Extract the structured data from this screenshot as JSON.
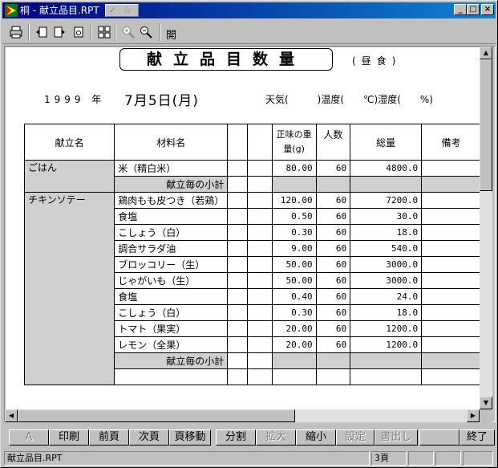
{
  "window": {
    "title": "桐 - 献立品目.RPT",
    "title_ghost": "CC"
  },
  "toolbar": {
    "open_label": "開"
  },
  "report": {
    "title": "献立品目数量",
    "meal": "(昼食)",
    "year": "1999 年",
    "month_day": "7月5日(月)",
    "weather": "天気(　　　)温度(　　℃)湿度(　　%)",
    "headers": {
      "dish": "献立名",
      "ingredient": "材料名",
      "weight": "正味の重量(g)",
      "people": "人数",
      "total": "総量",
      "note": "備考"
    },
    "subtotal_label": "献立毎の小計",
    "rows": [
      {
        "dish": "ごはん",
        "ingredient": "米（精白米）",
        "weight": "80.00",
        "people": "60",
        "total": "4800.0"
      },
      {
        "dish": "チキンソテー",
        "ingredient": "鶏肉もも皮つき（若鶏）",
        "weight": "120.00",
        "people": "60",
        "total": "7200.0"
      },
      {
        "ingredient": "食塩",
        "weight": "0.50",
        "people": "60",
        "total": "30.0"
      },
      {
        "ingredient": "こしょう（白）",
        "weight": "0.30",
        "people": "60",
        "total": "18.0"
      },
      {
        "ingredient": "調合サラダ油",
        "weight": "9.00",
        "people": "60",
        "total": "540.0"
      },
      {
        "ingredient": "ブロッコリー（生）",
        "weight": "50.00",
        "people": "60",
        "total": "3000.0"
      },
      {
        "ingredient": "じゃがいも（生）",
        "weight": "50.00",
        "people": "60",
        "total": "3000.0"
      },
      {
        "ingredient": "食塩",
        "weight": "0.40",
        "people": "60",
        "total": "24.0"
      },
      {
        "ingredient": "こしょう（白）",
        "weight": "0.30",
        "people": "60",
        "total": "18.0"
      },
      {
        "ingredient": "トマト（果実）",
        "weight": "20.00",
        "people": "60",
        "total": "1200.0"
      },
      {
        "ingredient": "レモン（全果）",
        "weight": "20.00",
        "people": "60",
        "total": "1200.0"
      }
    ]
  },
  "buttons": {
    "a": "A",
    "print": "印刷",
    "prev": "前頁",
    "next": "次頁",
    "goto": "頁移動",
    "split": "分割",
    "zoom_in": "拡大",
    "zoom_out": "縮小",
    "settings": "設定",
    "export": "書出し",
    "quit": "終了"
  },
  "statusbar": {
    "file": "献立品目.RPT",
    "page": "3頁"
  },
  "colors": {
    "titlebar": "#000080",
    "shade": "#d0d0d0"
  }
}
